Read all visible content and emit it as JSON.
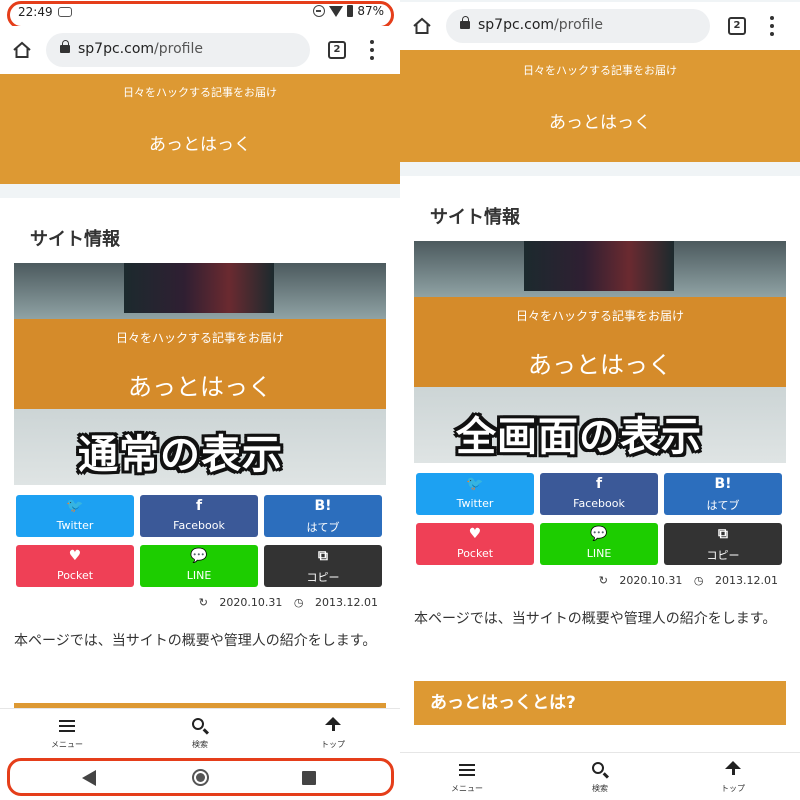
{
  "colors": {
    "header_bg": "#dd9933",
    "twitter": "#1da1f2",
    "facebook": "#3b5998",
    "hatena": "#2c6ebd",
    "pocket": "#ef4056",
    "line": "#1dcd00",
    "copy": "#333333",
    "highlight_outline": "#e53e1a"
  },
  "status_bar": {
    "time": "22:49",
    "battery": "87%"
  },
  "browser": {
    "url_domain": "sp7pc.com",
    "url_path": "/profile",
    "tab_count": "2"
  },
  "site": {
    "tagline": "日々をハックする記事をお届け",
    "name": "あっとはっく",
    "section_title": "サイト情報"
  },
  "share_buttons": [
    {
      "icon": "twitter-bird-icon",
      "glyph": "🐦",
      "label": "Twitter"
    },
    {
      "icon": "facebook-f-icon",
      "glyph": "f",
      "label": "Facebook"
    },
    {
      "icon": "hatena-bookmark-icon",
      "glyph": "B!",
      "label": "はてブ"
    },
    {
      "icon": "pocket-icon",
      "glyph": "♥",
      "label": "Pocket"
    },
    {
      "icon": "line-chat-icon",
      "glyph": "💬",
      "label": "LINE"
    },
    {
      "icon": "copy-icon",
      "glyph": "⧉",
      "label": "コピー"
    }
  ],
  "dates": {
    "updated": "2020.10.31",
    "published": "2013.12.01"
  },
  "body_text": "本ページでは、当サイトの概要や管理人の紹介をします。",
  "heading_about": "あっとはっくとは?",
  "bottom_nav": {
    "menu": "メニュー",
    "search": "検索",
    "top": "トップ"
  },
  "captions": {
    "normal": "通常の表示",
    "fullscreen": "全画面の表示"
  }
}
